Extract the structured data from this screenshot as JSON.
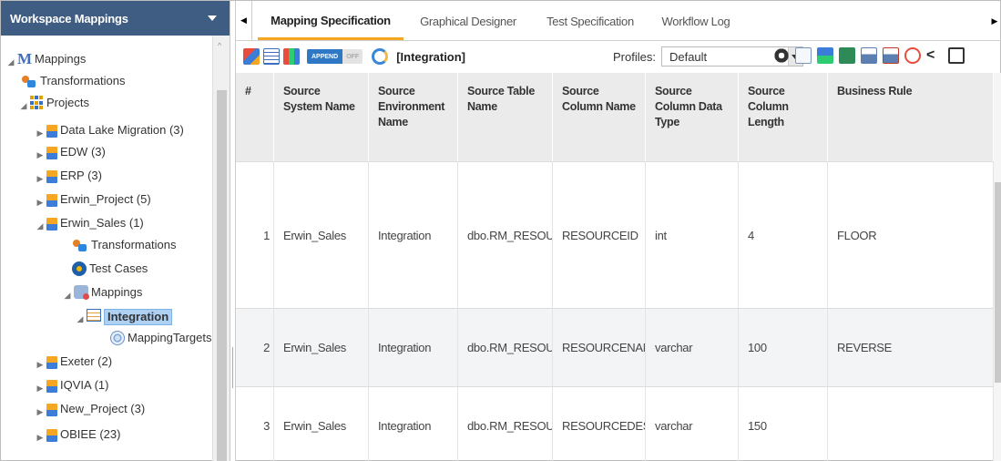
{
  "left_panel": {
    "title": "Workspace Mappings",
    "tree": [
      {
        "label": "Mappings",
        "icon": "mappings-m-icon",
        "arrow": "expanded"
      },
      {
        "label": "Transformations",
        "icon": "transformations-icon",
        "arrow": ""
      },
      {
        "label": "Projects",
        "icon": "projects-grid-icon",
        "arrow": "expanded"
      },
      {
        "label": "Data Lake Migration (3)",
        "icon": "project-icon",
        "arrow": "collapsed"
      },
      {
        "label": "EDW (3)",
        "icon": "project-icon",
        "arrow": "collapsed"
      },
      {
        "label": "ERP (3)",
        "icon": "project-icon",
        "arrow": "collapsed"
      },
      {
        "label": "Erwin_Project (5)",
        "icon": "project-icon",
        "arrow": "collapsed"
      },
      {
        "label": "Erwin_Sales (1)",
        "icon": "project-icon",
        "arrow": "expanded"
      },
      {
        "label": "Transformations",
        "icon": "transformations-icon",
        "arrow": ""
      },
      {
        "label": "Test Cases",
        "icon": "test-cases-icon",
        "arrow": ""
      },
      {
        "label": "Mappings",
        "icon": "mappings-folder-icon",
        "arrow": "expanded"
      },
      {
        "label": "Integration",
        "icon": "integration-mapping-icon",
        "arrow": "expanded"
      },
      {
        "label": "MappingTargets",
        "icon": "mapping-targets-icon",
        "arrow": ""
      },
      {
        "label": "Exeter (2)",
        "icon": "project-icon",
        "arrow": "collapsed"
      },
      {
        "label": "IQVIA (1)",
        "icon": "project-icon",
        "arrow": "collapsed"
      },
      {
        "label": "New_Project (3)",
        "icon": "project-icon",
        "arrow": "collapsed"
      },
      {
        "label": "OBIEE (23)",
        "icon": "project-icon",
        "arrow": "collapsed"
      }
    ]
  },
  "tabs": [
    {
      "label": "Mapping Specification",
      "active": true
    },
    {
      "label": "Graphical Designer",
      "active": false
    },
    {
      "label": "Test Specification",
      "active": false
    },
    {
      "label": "Workflow Log",
      "active": false
    }
  ],
  "toolbar": {
    "append_on": "APPEND",
    "append_off": "OFF",
    "mapping_name": "[Integration]",
    "profiles_label": "Profiles:",
    "profile_value": "Default"
  },
  "grid": {
    "headers": [
      "#",
      "Source System Name",
      "Source Environment Name",
      "Source Table Name",
      "Source Column Name",
      "Source Column Data Type",
      "Source Column Length",
      "Business Rule"
    ],
    "rows": [
      [
        "1",
        "Erwin_Sales",
        "Integration",
        "dbo.RM_RESOURCE",
        "RESOURCEID",
        "int",
        "4",
        "FLOOR"
      ],
      [
        "2",
        "Erwin_Sales",
        "Integration",
        "dbo.RM_RESOURCE",
        "RESOURCENAME",
        "varchar",
        "100",
        "REVERSE"
      ],
      [
        "3",
        "Erwin_Sales",
        "Integration",
        "dbo.RM_RESOURCE",
        "RESOURCEDESC",
        "varchar",
        "150",
        ""
      ]
    ]
  },
  "colors": {
    "header_bg": "#3f5d83",
    "active_tab_underline": "#f5a623",
    "selection": "#aed0f2"
  }
}
